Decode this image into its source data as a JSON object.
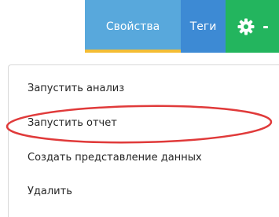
{
  "toolbar": {
    "properties_label": "Свойства",
    "tags_label": "Теги",
    "settings_icon": "gear-icon",
    "colors": {
      "properties": "#58a8dc",
      "properties_underline": "#f4bd34",
      "tags": "#3d8ad4",
      "settings": "#23b55e"
    }
  },
  "menu": {
    "items": [
      {
        "label": "Запустить анализ"
      },
      {
        "label": "Запустить отчет"
      },
      {
        "label": "Создать представление данных"
      },
      {
        "label": "Удалить"
      }
    ]
  },
  "annotation": {
    "color": "#e03a3a"
  }
}
